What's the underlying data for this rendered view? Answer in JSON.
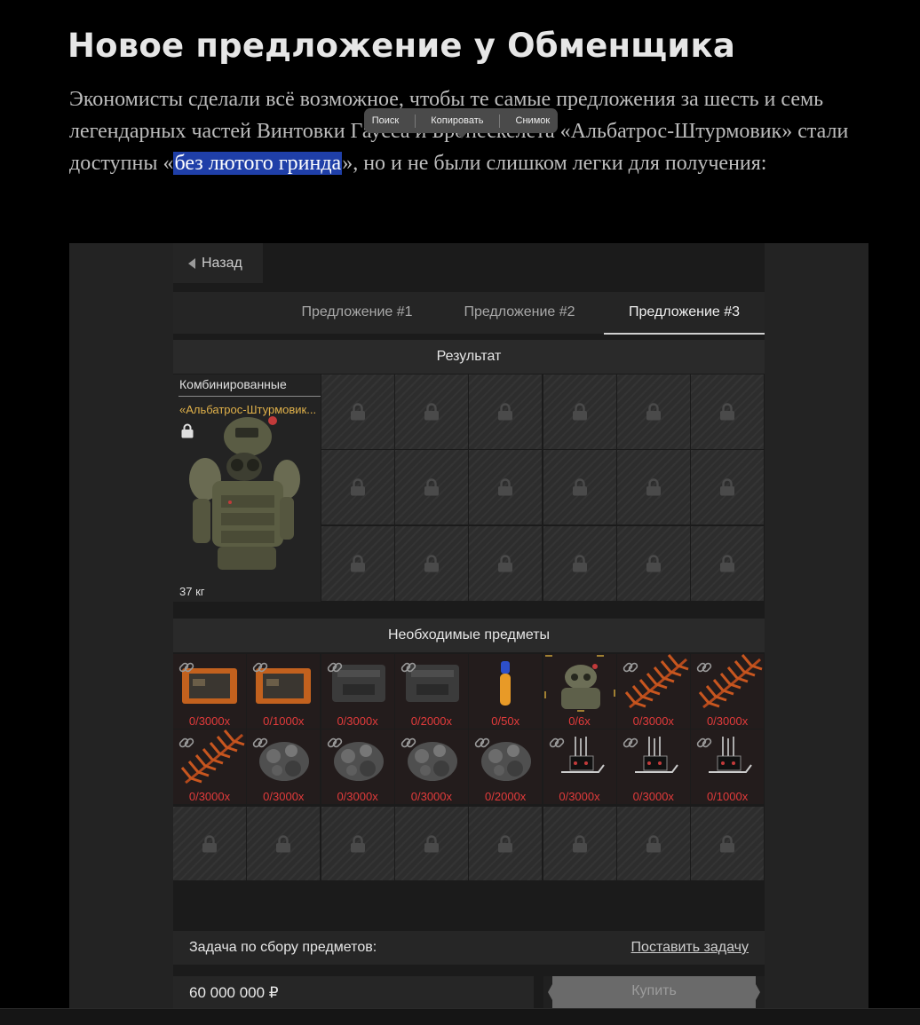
{
  "article": {
    "title": "Новое предложение у Обменщика",
    "p_before": "Экономисты сделали всё возможное, чтобы те самые предложения за шесть и семь легендарных частей Винтовки Гаусса и Бронескелета «Альбатрос-Штурмовик» стали доступны «",
    "p_highlight": "без лютого гринда",
    "p_after": "», но и не были слишком легки для получения:"
  },
  "popup": {
    "search": "Поиск",
    "copy": "Копировать",
    "snapshot": "Снимок"
  },
  "game": {
    "back_label": "Назад",
    "tabs": [
      "Предложение #1",
      "Предложение #2",
      "Предложение #3"
    ],
    "active_tab": 2,
    "result_header": "Результат",
    "result_item": {
      "category": "Комбинированные",
      "name": "«Альбатрос-Штурмовик...",
      "weight": "37 кг"
    },
    "required_header": "Необходимые предметы",
    "required_items": [
      {
        "count": "0/3000x",
        "kind": "device-orange"
      },
      {
        "count": "0/1000x",
        "kind": "device-orange"
      },
      {
        "count": "0/3000x",
        "kind": "case-dark"
      },
      {
        "count": "0/2000x",
        "kind": "case-dark"
      },
      {
        "count": "0/50x",
        "kind": "vial"
      },
      {
        "count": "0/6x",
        "kind": "armor-mini"
      },
      {
        "count": "0/3000x",
        "kind": "fern"
      },
      {
        "count": "0/3000x",
        "kind": "fern"
      },
      {
        "count": "0/3000x",
        "kind": "fern"
      },
      {
        "count": "0/3000x",
        "kind": "ore"
      },
      {
        "count": "0/3000x",
        "kind": "ore"
      },
      {
        "count": "0/3000x",
        "kind": "ore"
      },
      {
        "count": "0/2000x",
        "kind": "ore"
      },
      {
        "count": "0/3000x",
        "kind": "circuit"
      },
      {
        "count": "0/3000x",
        "kind": "circuit"
      },
      {
        "count": "0/1000x",
        "kind": "circuit"
      }
    ],
    "task_label": "Задача по сбору предметов:",
    "task_link": "Поставить задачу",
    "price": "60 000 000 ₽",
    "buy_label": "Купить",
    "colors": {
      "count_red": "#e23b3b",
      "item_name_gold": "#e0b14a",
      "selection_blue": "#1f3fa8"
    }
  }
}
